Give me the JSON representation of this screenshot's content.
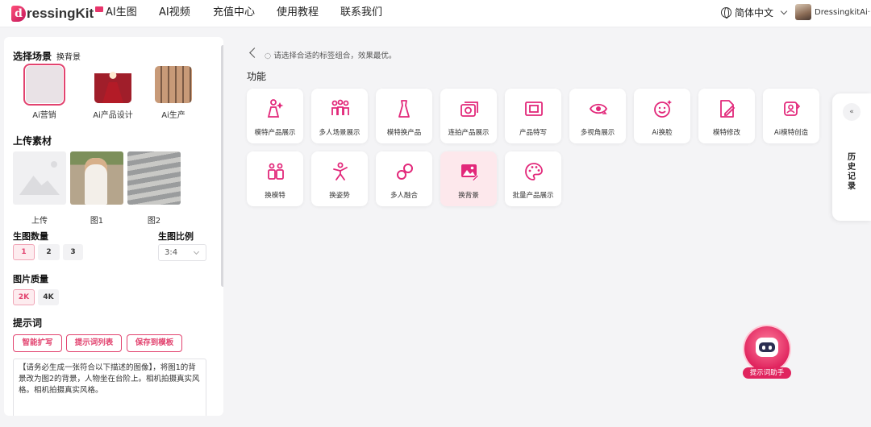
{
  "header": {
    "logo_text": "ressingKit",
    "logo_letter": "d",
    "nav": [
      "AI生图",
      "AI视频",
      "充值中心",
      "使用教程",
      "联系我们"
    ],
    "language": "简体中文",
    "username": "DressingkitAi···"
  },
  "left": {
    "scene_title": "选择场景",
    "scene_subtitle": "换背景",
    "scenes": [
      {
        "label": "Ai营销",
        "selected": true
      },
      {
        "label": "Ai产品设计",
        "selected": false
      },
      {
        "label": "Ai生产",
        "selected": false
      }
    ],
    "material_title": "上传素材",
    "materials": [
      "上传",
      "图1",
      "图2"
    ],
    "count_title": "生图数量",
    "counts": [
      "1",
      "2",
      "3"
    ],
    "count_selected": "1",
    "ratio_title": "生图比例",
    "ratio_value": "3:4",
    "quality_title": "图片质量",
    "qualities": [
      "2K",
      "4K"
    ],
    "quality_selected": "2K",
    "prompt_title": "提示词",
    "prompt_buttons": [
      "智能扩写",
      "提示词列表",
      "保存到模板"
    ],
    "prompt_text": "【请务必生成一张符合以下描述的图像】，将图1的背景改为图2的背景，人物坐在台阶上。相机拍摄真实风格。相机拍摄真实风格。"
  },
  "main": {
    "tip": "请选择合适的标签组合，效果最优。",
    "function_title": "功能",
    "functions_row1": [
      "模特产品展示",
      "多人场景展示",
      "模特换产品",
      "连拍产品展示",
      "产品特写",
      "多视角展示",
      "Ai换脸",
      "模特修改",
      "Ai模特创造"
    ],
    "functions_row2": [
      "换模特",
      "换姿势",
      "多人融合",
      "换背景",
      "批量产品展示"
    ],
    "active_function": "换背景",
    "accent_color": "#e2287a"
  },
  "history": {
    "collapse_glyph": "«",
    "label": "历史记录"
  },
  "assistant": {
    "label": "提示词助手"
  }
}
